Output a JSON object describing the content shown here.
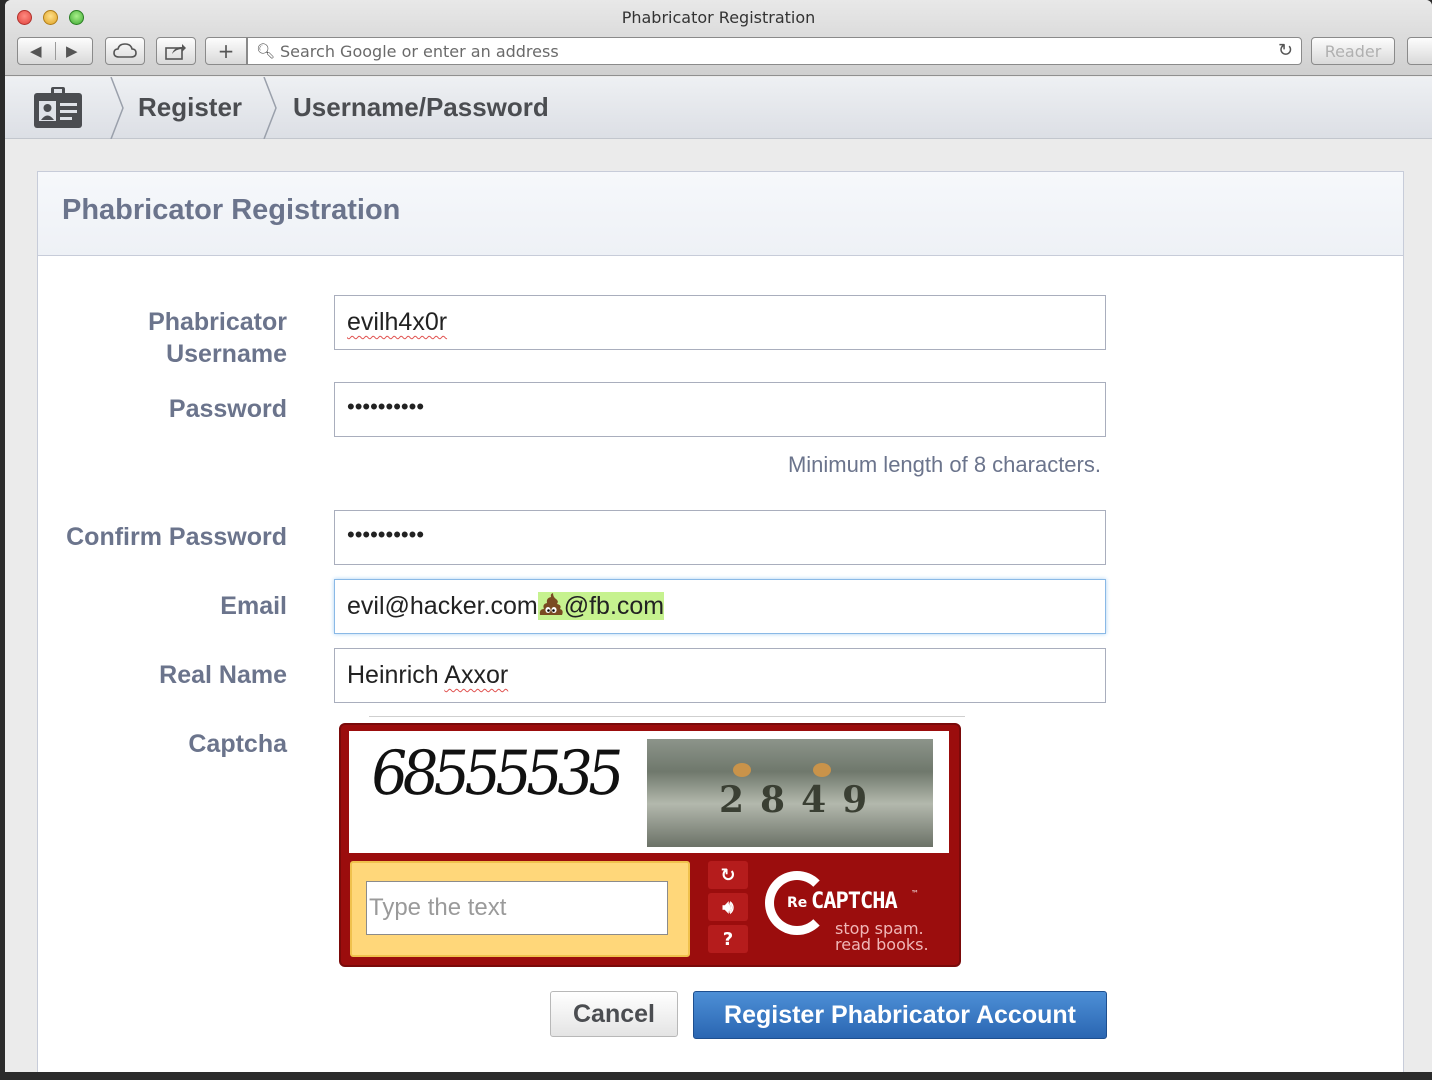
{
  "window": {
    "title": "Phabricator Registration"
  },
  "toolbar": {
    "address_placeholder": "Search Google or enter an address",
    "reader_label": "Reader",
    "plus_label": "+"
  },
  "breadcrumbs": [
    {
      "label": "Register"
    },
    {
      "label": "Username/Password"
    }
  ],
  "panel": {
    "title": "Phabricator Registration"
  },
  "form": {
    "username": {
      "label_line1": "Phabricator",
      "label_line2": "Username",
      "value": "evilh4x0r"
    },
    "password": {
      "label": "Password",
      "value": "••••••••••"
    },
    "password_hint": "Minimum length of 8 characters.",
    "confirm_password": {
      "label": "Confirm Password",
      "value": "••••••••••"
    },
    "email": {
      "label": "Email",
      "value_prefix": "evil@hacker.com",
      "value_suffix": "@fb.com"
    },
    "real_name": {
      "label": "Real Name",
      "first": "Heinrich",
      "last": "Axxor"
    },
    "captcha": {
      "label": "Captcha",
      "word": "68555535",
      "photo_number": "2849",
      "input_placeholder": "Type the text",
      "brand_re": "Re",
      "brand_name": "CAPTCHA",
      "brand_tm": "™",
      "tagline_1": "stop spam.",
      "tagline_2": "read books."
    }
  },
  "buttons": {
    "cancel": "Cancel",
    "register": "Register Phabricator Account"
  },
  "colors": {
    "accent": "#2f6fbd",
    "label": "#6b748c",
    "recaptcha_red": "#9b0d0d",
    "email_highlight": "#c6f28f"
  }
}
